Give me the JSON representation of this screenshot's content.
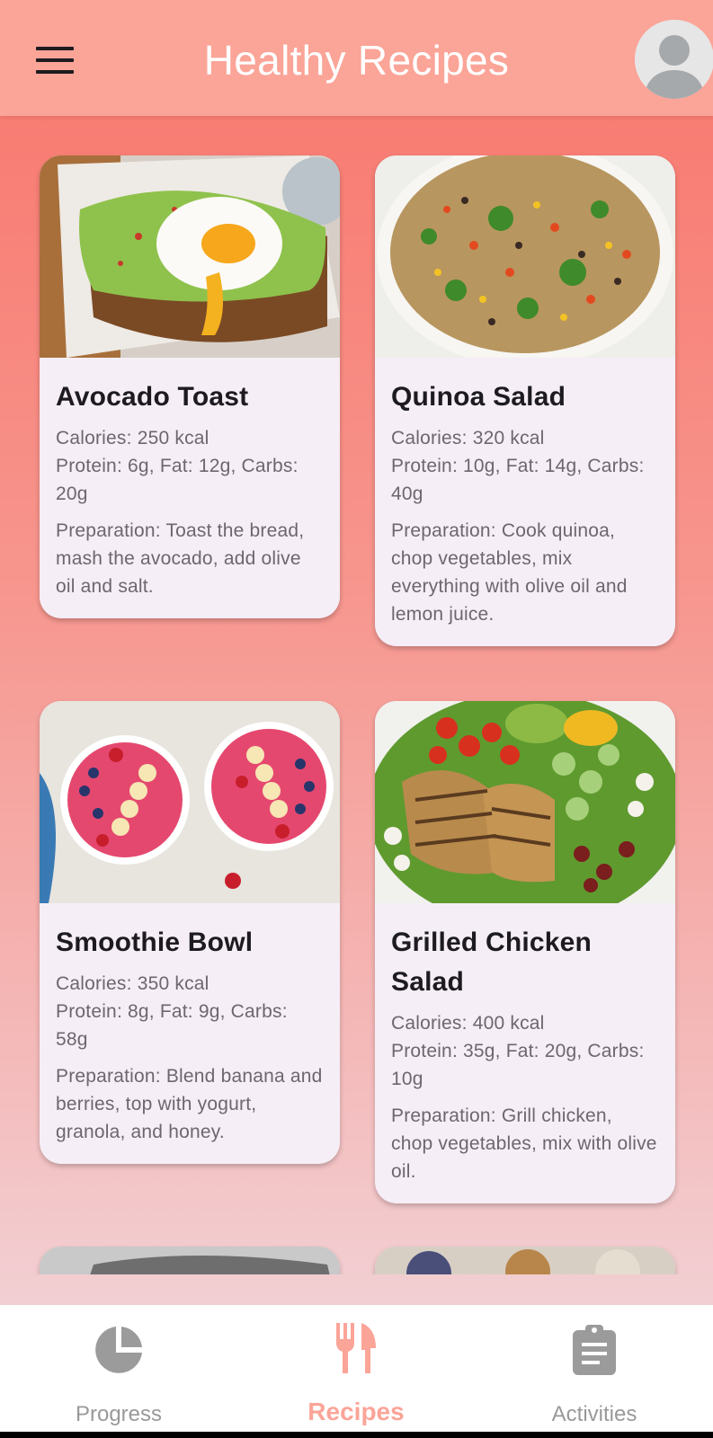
{
  "app": {
    "title": "Healthy Recipes"
  },
  "header": {
    "menu_icon": "menu-icon",
    "avatar_icon": "avatar-icon"
  },
  "recipes": [
    {
      "name": "Avocado Toast",
      "calories": "Calories: 250 kcal",
      "macros": "Protein: 6g, Fat: 12g, Carbs: 20g",
      "preparation": "Preparation: Toast the bread, mash the avocado, add olive oil and salt."
    },
    {
      "name": "Quinoa Salad",
      "calories": "Calories: 320 kcal",
      "macros": "Protein: 10g, Fat: 14g, Carbs: 40g",
      "preparation": "Preparation: Cook quinoa, chop vegetables, mix everything with olive oil and lemon juice."
    },
    {
      "name": "Smoothie Bowl",
      "calories": "Calories: 350 kcal",
      "macros": "Protein: 8g, Fat: 9g, Carbs: 58g",
      "preparation": "Preparation: Blend banana and berries, top with yogurt, granola, and honey."
    },
    {
      "name": "Grilled Chicken Salad",
      "calories": "Calories: 400 kcal",
      "macros": "Protein: 35g, Fat: 20g, Carbs: 10g",
      "preparation": "Preparation: Grill chicken, chop vegetables, mix with olive oil."
    }
  ],
  "bottom_nav": {
    "items": [
      {
        "label": "Progress",
        "icon": "pie-chart-icon",
        "active": false
      },
      {
        "label": "Recipes",
        "icon": "fork-knife-icon",
        "active": true
      },
      {
        "label": "Activities",
        "icon": "clipboard-icon",
        "active": false
      }
    ]
  },
  "colors": {
    "app_bar": "#fba498",
    "accent": "#fba498",
    "card_background": "#f5eef6",
    "inactive_nav": "#999999"
  }
}
